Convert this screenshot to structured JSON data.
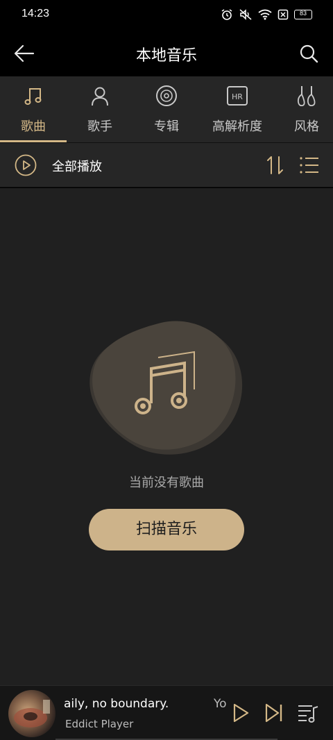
{
  "status_bar": {
    "time": "14:23",
    "battery": "83",
    "icons": [
      "alarm-icon",
      "mute-icon",
      "wifi-icon",
      "sim-off-icon",
      "battery-icon"
    ]
  },
  "header": {
    "title": "本地音乐",
    "back_icon": "back-arrow-icon",
    "search_icon": "search-icon"
  },
  "tabs": [
    {
      "label": "歌曲",
      "icon": "music-note-icon",
      "active": true
    },
    {
      "label": "歌手",
      "icon": "person-icon",
      "active": false
    },
    {
      "label": "专辑",
      "icon": "disc-icon",
      "active": false
    },
    {
      "label": "高解析度",
      "icon": "hr-icon",
      "active": false
    },
    {
      "label": "风格",
      "icon": "guitar-icon",
      "active": false
    }
  ],
  "toolbar": {
    "play_all_label": "全部播放",
    "sort_icon": "sort-icon",
    "list_icon": "list-icon"
  },
  "empty_state": {
    "message": "当前没有歌曲",
    "scan_button_label": "扫描音乐"
  },
  "player": {
    "track_title": "aily, no boundary.",
    "track_title_next": "Yo",
    "artist": "Eddict Player",
    "progress": 0.0
  },
  "colors": {
    "accent": "#d4b887",
    "button": "#cdb38a",
    "background": "#202020",
    "panel": "#262626"
  }
}
